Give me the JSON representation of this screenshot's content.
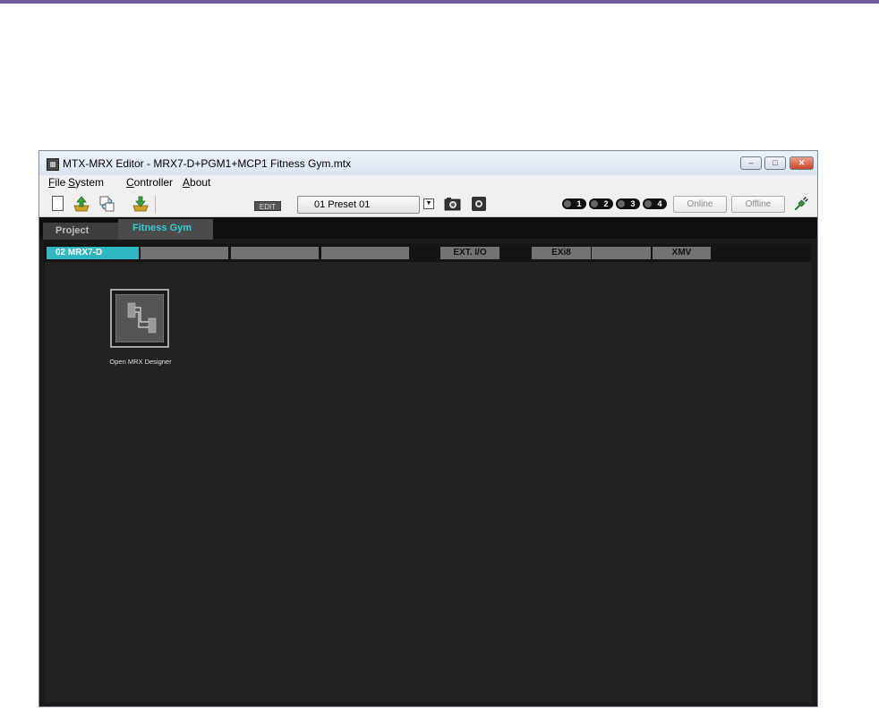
{
  "window": {
    "title": "MTX-MRX Editor - MRX7-D+PGM1+MCP1 Fitness Gym.mtx",
    "controls": {
      "minimize": "–",
      "maximize": "□",
      "close": "✕"
    }
  },
  "menu": {
    "items": [
      {
        "ul": "F",
        "rest": "ile"
      },
      {
        "ul": "S",
        "rest": "ystem"
      },
      {
        "ul": "C",
        "rest": "ontroller"
      },
      {
        "ul": "A",
        "rest": "bout"
      }
    ]
  },
  "toolbar": {
    "edit_badge": "EDIT",
    "preset": "01 Preset 01",
    "preset_dropdown_glyph": "▼",
    "pills": [
      "1",
      "2",
      "3",
      "4"
    ],
    "online": "Online",
    "offline": "Offline"
  },
  "tabs": [
    "Project",
    "Fitness Gym"
  ],
  "devices": {
    "main": "02 MRX7-D",
    "ext_io": "EXT. I/O",
    "exi8": "EXi8",
    "xmv": "XMV"
  },
  "designer": {
    "label": "Open MRX Designer"
  },
  "colors": {
    "accent": "#2fb8c1",
    "tab_active_text": "#36cfd4",
    "page_top_bar": "#6b5b98"
  }
}
